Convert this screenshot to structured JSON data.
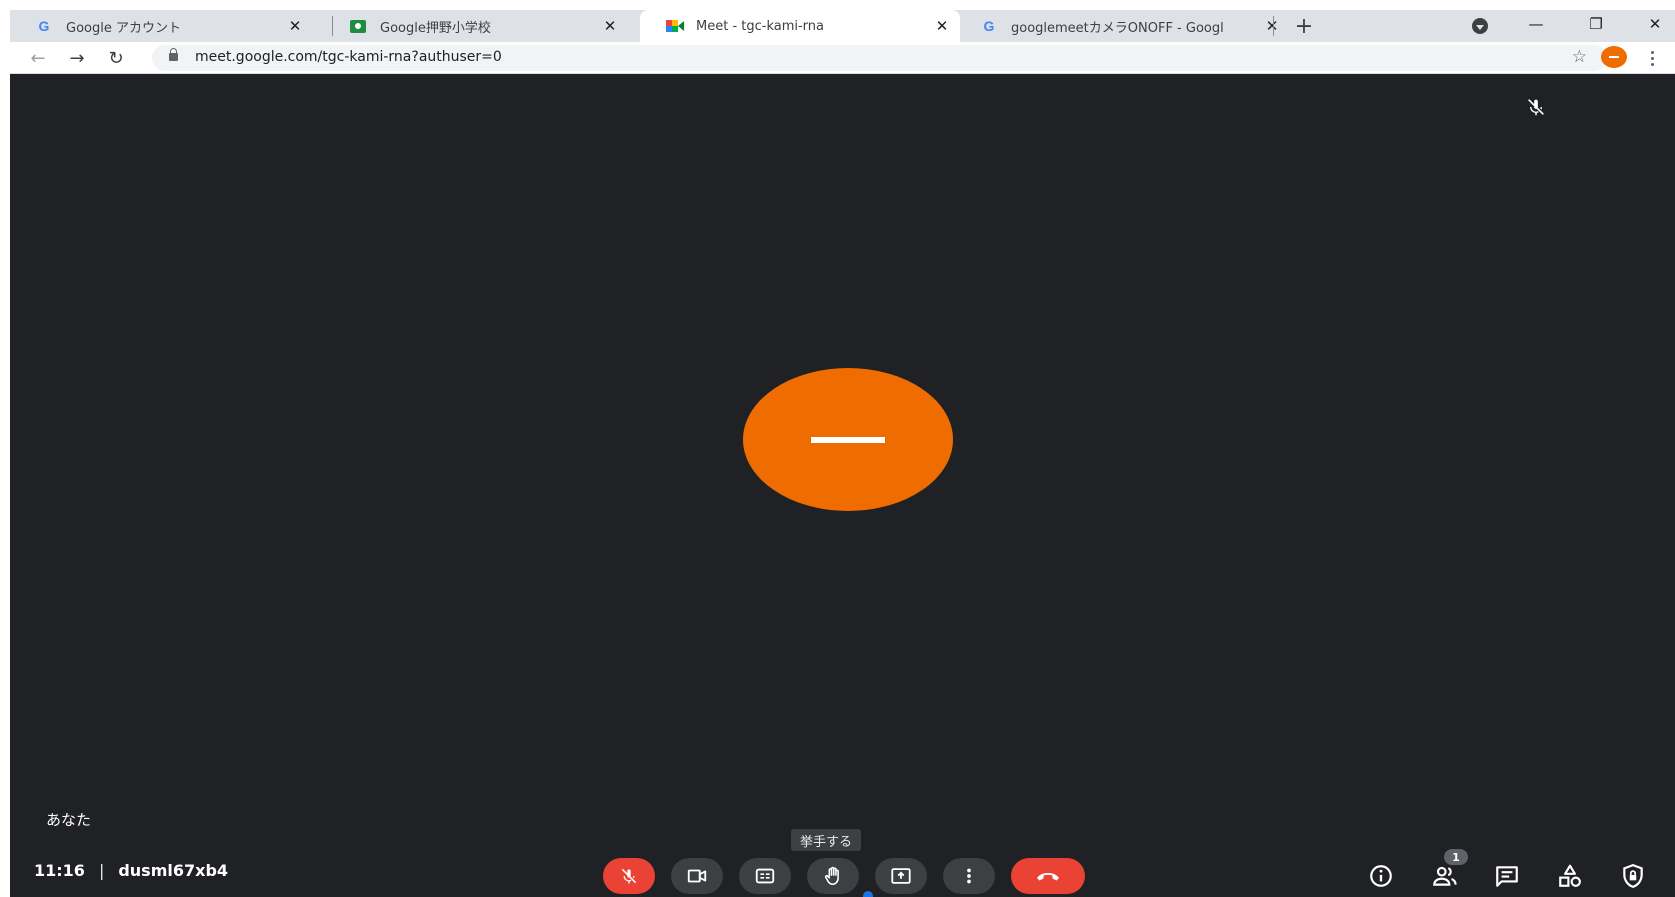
{
  "browser": {
    "tabs": [
      {
        "title": "Google アカウント",
        "icon": "google-g-icon"
      },
      {
        "title": "Google押野小学校",
        "icon": "classroom-icon"
      },
      {
        "title": "Meet - tgc-kami-rna",
        "icon": "meet-icon",
        "active": true
      },
      {
        "title": "googlemeetカメラONOFF - Googl",
        "icon": "google-g-icon"
      }
    ],
    "new_tab_symbol": "+",
    "url": "meet.google.com/tgc-kami-rna?authuser=0",
    "window_controls": {
      "minimize": "—",
      "restore": "❐",
      "close": "✕"
    },
    "nav": {
      "back": "←",
      "forward": "→",
      "reload": "↻"
    },
    "star": "☆"
  },
  "meet": {
    "self_label": "あなた",
    "time": "11:16",
    "separator": "|",
    "meeting_code": "dusml67xb4",
    "tooltip": "挙手する",
    "participant_count": "1",
    "colors": {
      "stage_bg": "#202124",
      "avatar": "#ef6c00",
      "danger": "#ea4335",
      "control_bg": "#3c4043"
    },
    "controls": [
      "mic-off-icon",
      "camera-icon",
      "captions-icon",
      "raise-hand-icon",
      "present-screen-icon",
      "more-options-icon",
      "end-call-icon"
    ],
    "right_controls": [
      "info-icon",
      "people-icon",
      "chat-icon",
      "activities-icon",
      "host-controls-icon"
    ]
  }
}
